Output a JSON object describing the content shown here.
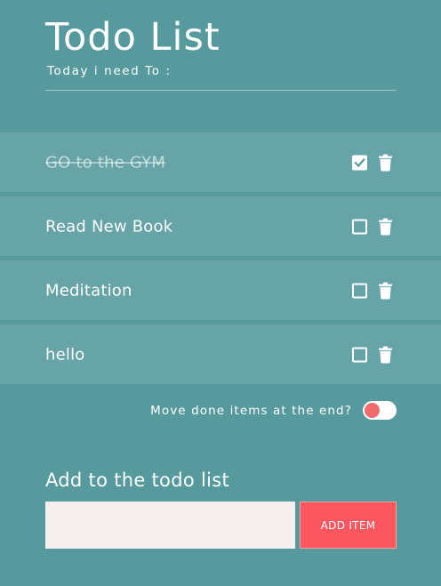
{
  "header": {
    "title": "Todo List",
    "subtitle": "Today i need To :"
  },
  "todos": [
    {
      "text": "GO to the GYM",
      "done": true
    },
    {
      "text": "Read New Book",
      "done": false
    },
    {
      "text": "Meditation",
      "done": false
    },
    {
      "text": "hello",
      "done": false
    }
  ],
  "settings": {
    "move_done_label": "Move done items at the end?",
    "move_done_enabled": false
  },
  "add_form": {
    "title": "Add to the todo list",
    "input_value": "",
    "button_label": "ADD ITEM"
  },
  "colors": {
    "background": "#569a9e",
    "row": "#66a4a7",
    "accent": "#fc575e",
    "input": "#f6efef"
  },
  "icons": {
    "checkbox": "checkbox-icon",
    "trash": "trash-icon"
  }
}
